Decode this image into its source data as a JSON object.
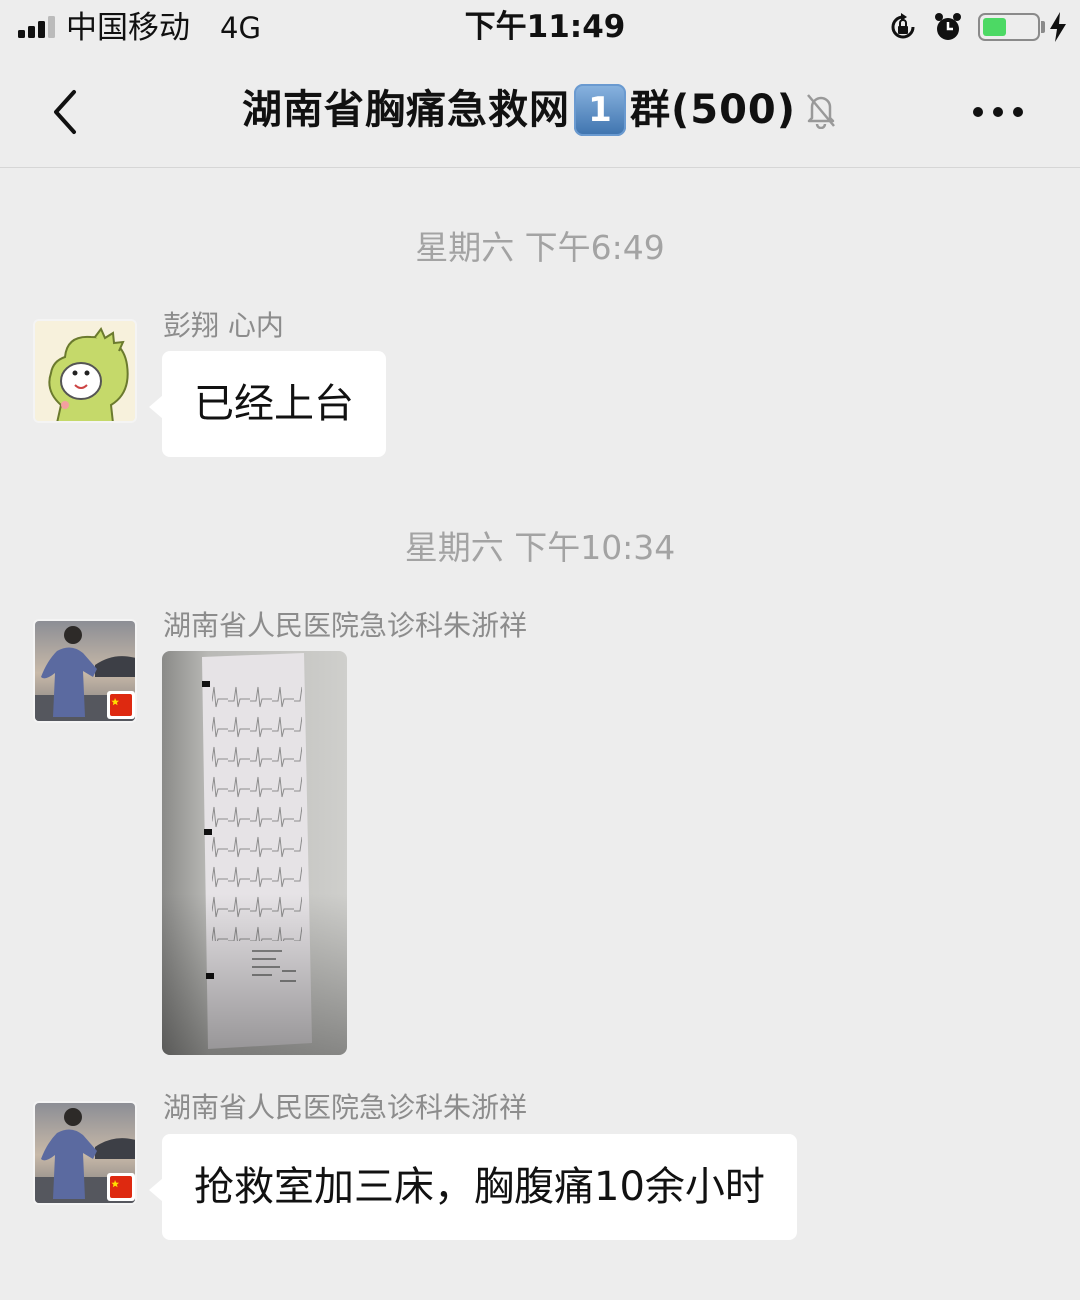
{
  "status_bar": {
    "carrier": "中国移动",
    "network": "4G",
    "time": "下午11:49",
    "battery_level": 0.45,
    "icons": [
      "signal-icon",
      "orientation-lock-icon",
      "alarm-icon",
      "battery-icon",
      "charging-icon"
    ]
  },
  "nav": {
    "title_prefix": "湖南省胸痛急救网",
    "title_badge": "1",
    "title_suffix": "群(500)",
    "icons": [
      "back-icon",
      "mute-icon",
      "more-icon"
    ]
  },
  "chat": {
    "timestamps": [
      "星期六 下午6:49",
      "星期六 下午10:34"
    ],
    "messages": [
      {
        "sender": "彭翔 心内",
        "type": "text",
        "text": "已经上台",
        "avatar": "dinosaur-sticker-avatar"
      },
      {
        "sender": "湖南省人民医院急诊科朱浙祥",
        "type": "image",
        "image": "ecg-printout-photo",
        "avatar": "man-photo-avatar"
      },
      {
        "sender": "湖南省人民医院急诊科朱浙祥",
        "type": "text",
        "text": "抢救室加三床，胸腹痛10余小时",
        "avatar": "man-photo-avatar"
      }
    ]
  },
  "colors": {
    "background": "#ededed",
    "bubble": "#ffffff",
    "battery": "#4cd964",
    "secondary_text": "#a3a3a3"
  }
}
